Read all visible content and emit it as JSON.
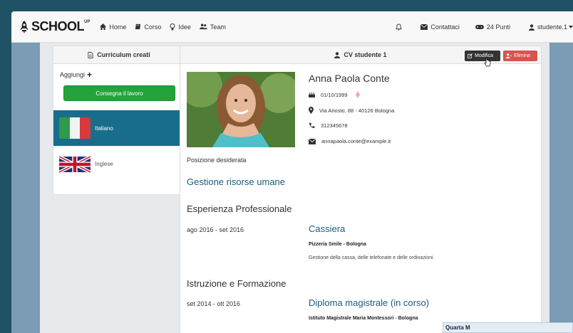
{
  "brand": {
    "name": "SCHOOL",
    "sup": "UP"
  },
  "nav": {
    "home": "Home",
    "corso": "Corso",
    "idee": "Idee",
    "team": "Team",
    "contattaci": "Contattaci",
    "punti": "24 Punti",
    "user": "studente.1"
  },
  "left_panel": {
    "title": "Curriculum creati",
    "add_label": "Aggiungi",
    "submit_button": "Consegna il lavoro",
    "languages": [
      {
        "label": "Italiano",
        "active": true
      },
      {
        "label": "Inglese",
        "active": false
      }
    ]
  },
  "cv": {
    "header_title": "CV studente 1",
    "edit_button": "Modifica",
    "delete_button": "Elimina",
    "name": "Anna Paola Conte",
    "birthdate": "01/10/1999",
    "address": "Via Ariosto, 88 - 40126 Bologna",
    "phone": "312345678",
    "email": "annapaola.conte@example.it",
    "position_label": "Posizione desiderata",
    "position_value": "Gestione risorse umane",
    "experience_title": "Esperienza Professionale",
    "experience": {
      "dates": "ago 2016 - set 2016",
      "title": "Cassiera",
      "company": "Pizzeria Smile - Bologna",
      "description": "Gestione della cassa, delle telefonate e delle ordinazioni"
    },
    "education_title": "Istruzione e Formazione",
    "education": {
      "dates": "set 2014 - ott 2016",
      "title": "Diploma magistrale (in corso)",
      "institute": "Istituto Magistrale Maria Montessori - Bologna"
    }
  },
  "popup": {
    "label": "Quarta M"
  },
  "colors": {
    "navbar_bg": "#f8f8f8",
    "accent_blue": "#196d8c",
    "link_blue": "#1d5b78",
    "green_button": "#24a33c",
    "danger": "#d9534f",
    "side_bg": "#7c9bb4",
    "frame_bg": "#1e5264"
  }
}
